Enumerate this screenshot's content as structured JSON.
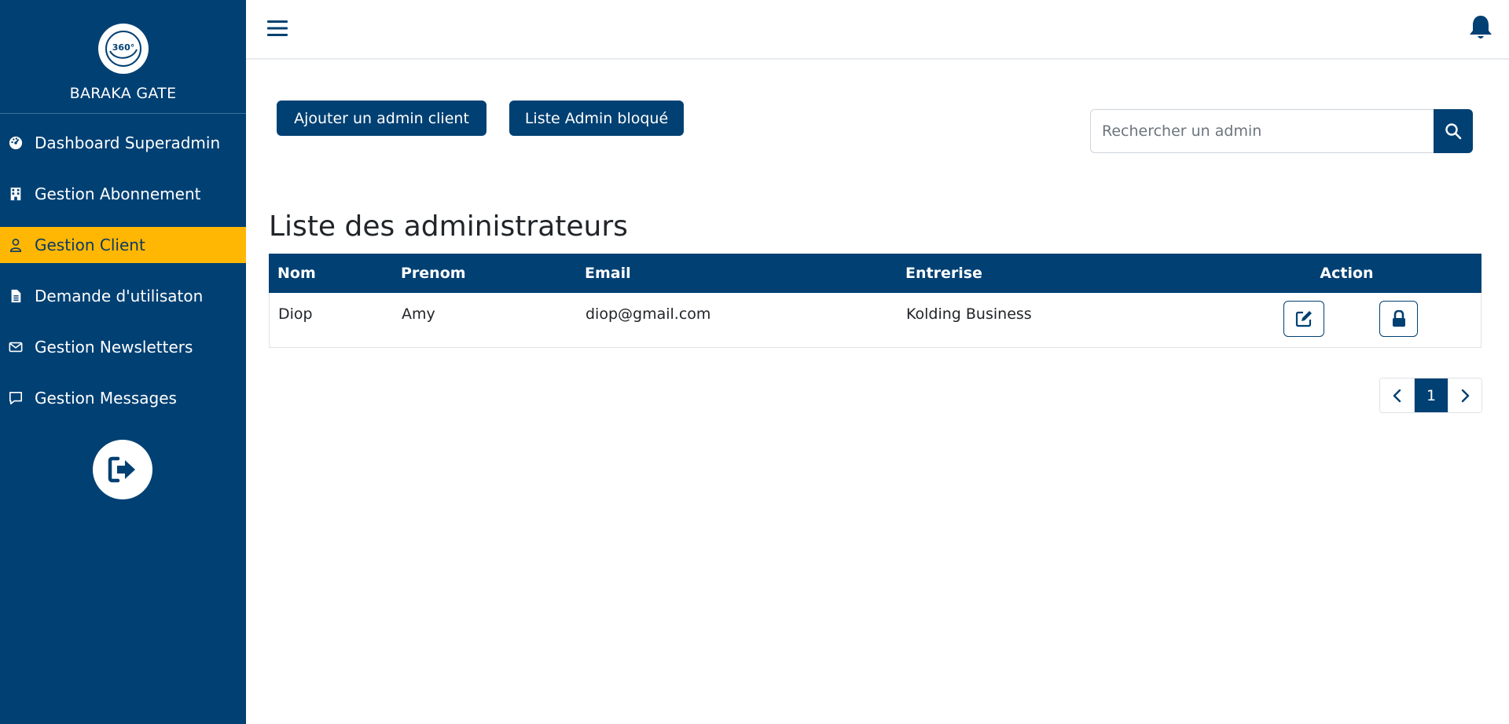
{
  "brand": {
    "name": "BARAKA GATE",
    "logo_text": "360°"
  },
  "sidebar": {
    "items": [
      {
        "label": "Dashboard Superadmin",
        "icon": "dashboard-icon"
      },
      {
        "label": "Gestion Abonnement",
        "icon": "building-icon"
      },
      {
        "label": "Gestion Client",
        "icon": "user-icon",
        "active": true
      },
      {
        "label": "Demande d'utilisaton",
        "icon": "file-icon"
      },
      {
        "label": "Gestion Newsletters",
        "icon": "envelope-icon"
      },
      {
        "label": "Gestion Messages",
        "icon": "comment-icon"
      }
    ],
    "logout_icon": "sign-out-icon"
  },
  "topbar": {
    "menu_icon": "hamburger-icon",
    "notification_icon": "bell-icon"
  },
  "toolbar": {
    "add_admin_label": "Ajouter un admin client",
    "blocked_list_label": "Liste Admin bloqué"
  },
  "search": {
    "placeholder": "Rechercher un admin",
    "value": "",
    "icon": "search-icon"
  },
  "main": {
    "title": "Liste des administrateurs"
  },
  "table": {
    "headers": {
      "nom": "Nom",
      "prenom": "Prenom",
      "email": "Email",
      "entreprise": "Entrerise",
      "action": "Action"
    },
    "rows": [
      {
        "nom": "Diop",
        "prenom": "Amy",
        "email": "diop@gmail.com",
        "entreprise": "Kolding Business",
        "actions": [
          "edit-icon",
          "lock-icon"
        ]
      }
    ]
  },
  "pagination": {
    "current_page": "1",
    "prev_icon": "chevron-left-icon",
    "next_icon": "chevron-right-icon"
  },
  "colors": {
    "primary": "#004073",
    "active_nav": "#ffb703",
    "text": "#212529",
    "white": "#ffffff"
  }
}
